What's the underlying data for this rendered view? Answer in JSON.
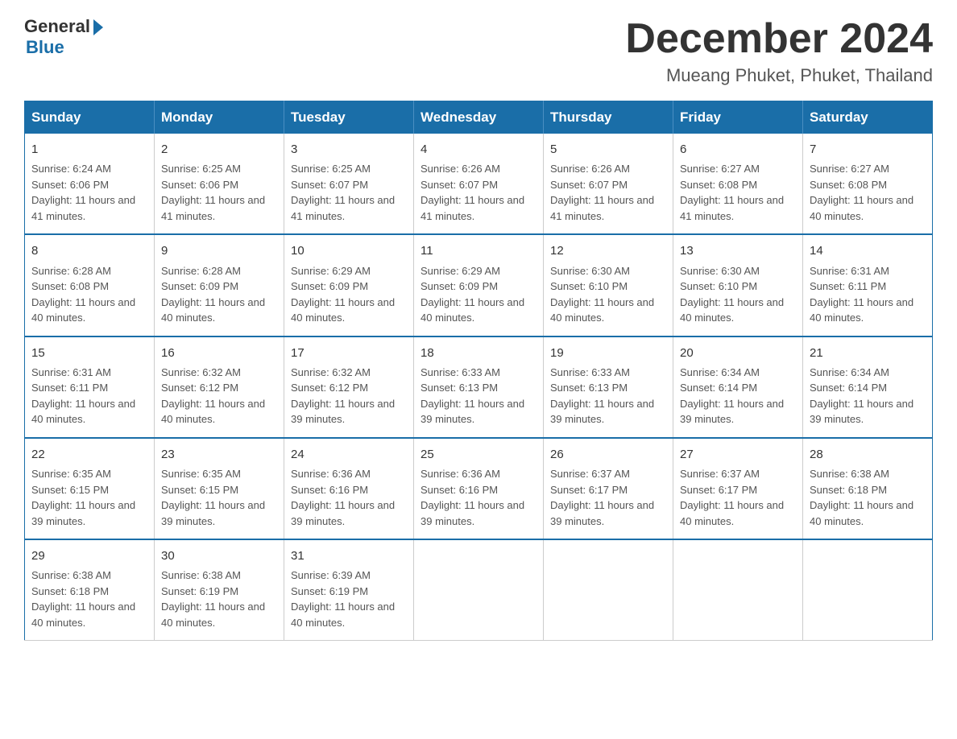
{
  "logo": {
    "general": "General",
    "blue": "Blue"
  },
  "title": {
    "month_year": "December 2024",
    "location": "Mueang Phuket, Phuket, Thailand"
  },
  "weekdays": [
    "Sunday",
    "Monday",
    "Tuesday",
    "Wednesday",
    "Thursday",
    "Friday",
    "Saturday"
  ],
  "weeks": [
    [
      {
        "day": "1",
        "sunrise": "6:24 AM",
        "sunset": "6:06 PM",
        "daylight": "11 hours and 41 minutes."
      },
      {
        "day": "2",
        "sunrise": "6:25 AM",
        "sunset": "6:06 PM",
        "daylight": "11 hours and 41 minutes."
      },
      {
        "day": "3",
        "sunrise": "6:25 AM",
        "sunset": "6:07 PM",
        "daylight": "11 hours and 41 minutes."
      },
      {
        "day": "4",
        "sunrise": "6:26 AM",
        "sunset": "6:07 PM",
        "daylight": "11 hours and 41 minutes."
      },
      {
        "day": "5",
        "sunrise": "6:26 AM",
        "sunset": "6:07 PM",
        "daylight": "11 hours and 41 minutes."
      },
      {
        "day": "6",
        "sunrise": "6:27 AM",
        "sunset": "6:08 PM",
        "daylight": "11 hours and 41 minutes."
      },
      {
        "day": "7",
        "sunrise": "6:27 AM",
        "sunset": "6:08 PM",
        "daylight": "11 hours and 40 minutes."
      }
    ],
    [
      {
        "day": "8",
        "sunrise": "6:28 AM",
        "sunset": "6:08 PM",
        "daylight": "11 hours and 40 minutes."
      },
      {
        "day": "9",
        "sunrise": "6:28 AM",
        "sunset": "6:09 PM",
        "daylight": "11 hours and 40 minutes."
      },
      {
        "day": "10",
        "sunrise": "6:29 AM",
        "sunset": "6:09 PM",
        "daylight": "11 hours and 40 minutes."
      },
      {
        "day": "11",
        "sunrise": "6:29 AM",
        "sunset": "6:09 PM",
        "daylight": "11 hours and 40 minutes."
      },
      {
        "day": "12",
        "sunrise": "6:30 AM",
        "sunset": "6:10 PM",
        "daylight": "11 hours and 40 minutes."
      },
      {
        "day": "13",
        "sunrise": "6:30 AM",
        "sunset": "6:10 PM",
        "daylight": "11 hours and 40 minutes."
      },
      {
        "day": "14",
        "sunrise": "6:31 AM",
        "sunset": "6:11 PM",
        "daylight": "11 hours and 40 minutes."
      }
    ],
    [
      {
        "day": "15",
        "sunrise": "6:31 AM",
        "sunset": "6:11 PM",
        "daylight": "11 hours and 40 minutes."
      },
      {
        "day": "16",
        "sunrise": "6:32 AM",
        "sunset": "6:12 PM",
        "daylight": "11 hours and 40 minutes."
      },
      {
        "day": "17",
        "sunrise": "6:32 AM",
        "sunset": "6:12 PM",
        "daylight": "11 hours and 39 minutes."
      },
      {
        "day": "18",
        "sunrise": "6:33 AM",
        "sunset": "6:13 PM",
        "daylight": "11 hours and 39 minutes."
      },
      {
        "day": "19",
        "sunrise": "6:33 AM",
        "sunset": "6:13 PM",
        "daylight": "11 hours and 39 minutes."
      },
      {
        "day": "20",
        "sunrise": "6:34 AM",
        "sunset": "6:14 PM",
        "daylight": "11 hours and 39 minutes."
      },
      {
        "day": "21",
        "sunrise": "6:34 AM",
        "sunset": "6:14 PM",
        "daylight": "11 hours and 39 minutes."
      }
    ],
    [
      {
        "day": "22",
        "sunrise": "6:35 AM",
        "sunset": "6:15 PM",
        "daylight": "11 hours and 39 minutes."
      },
      {
        "day": "23",
        "sunrise": "6:35 AM",
        "sunset": "6:15 PM",
        "daylight": "11 hours and 39 minutes."
      },
      {
        "day": "24",
        "sunrise": "6:36 AM",
        "sunset": "6:16 PM",
        "daylight": "11 hours and 39 minutes."
      },
      {
        "day": "25",
        "sunrise": "6:36 AM",
        "sunset": "6:16 PM",
        "daylight": "11 hours and 39 minutes."
      },
      {
        "day": "26",
        "sunrise": "6:37 AM",
        "sunset": "6:17 PM",
        "daylight": "11 hours and 39 minutes."
      },
      {
        "day": "27",
        "sunrise": "6:37 AM",
        "sunset": "6:17 PM",
        "daylight": "11 hours and 40 minutes."
      },
      {
        "day": "28",
        "sunrise": "6:38 AM",
        "sunset": "6:18 PM",
        "daylight": "11 hours and 40 minutes."
      }
    ],
    [
      {
        "day": "29",
        "sunrise": "6:38 AM",
        "sunset": "6:18 PM",
        "daylight": "11 hours and 40 minutes."
      },
      {
        "day": "30",
        "sunrise": "6:38 AM",
        "sunset": "6:19 PM",
        "daylight": "11 hours and 40 minutes."
      },
      {
        "day": "31",
        "sunrise": "6:39 AM",
        "sunset": "6:19 PM",
        "daylight": "11 hours and 40 minutes."
      },
      null,
      null,
      null,
      null
    ]
  ]
}
